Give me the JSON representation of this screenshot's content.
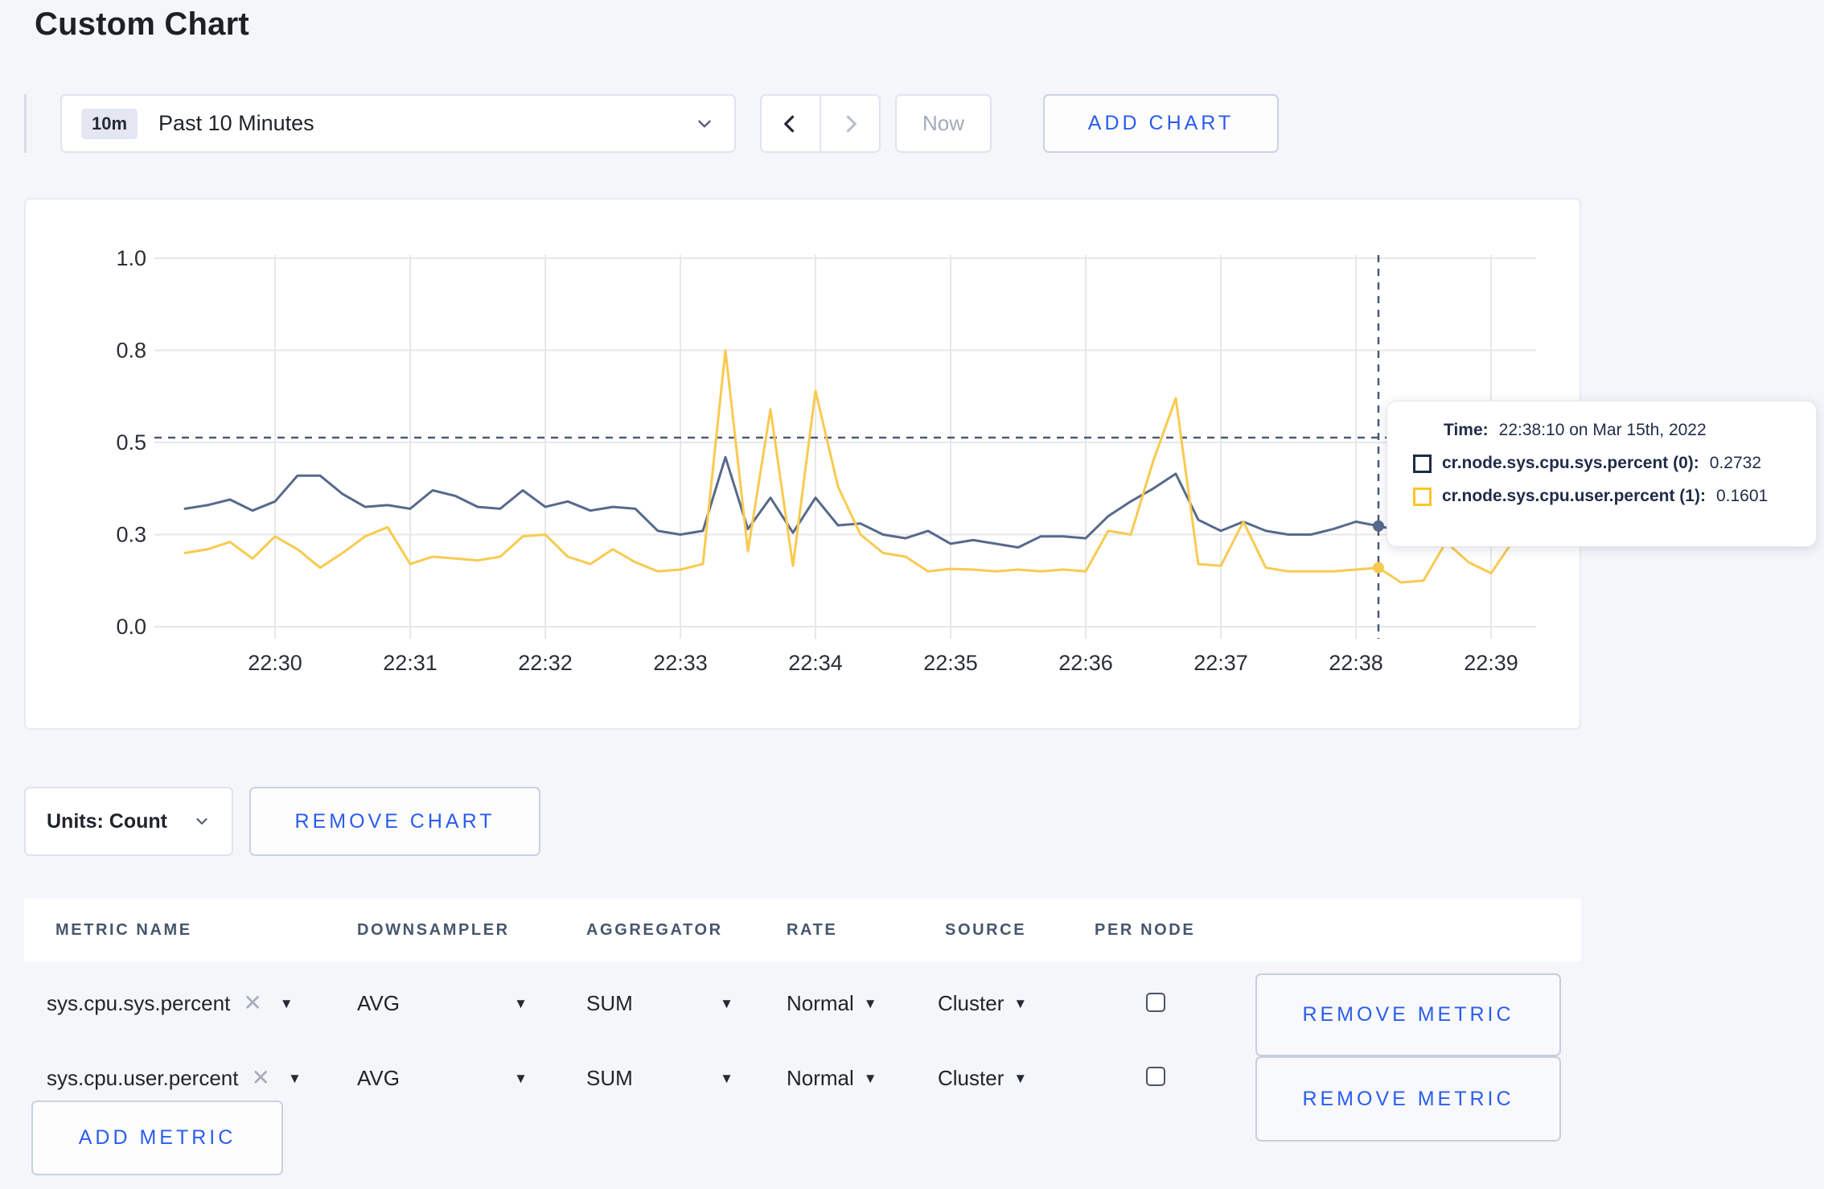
{
  "page_title": "Custom Chart",
  "toolbar": {
    "time_range_badge": "10m",
    "time_range_label": "Past 10 Minutes",
    "prev_label": "previous time window",
    "next_label": "next time window",
    "now_label": "Now",
    "add_chart_label": "ADD CHART"
  },
  "chart_data": {
    "type": "line",
    "title": "",
    "xlabel": "",
    "ylabel": "",
    "ylim": [
      0,
      1
    ],
    "grid": true,
    "x_start_time": "22:29:20",
    "x_step_seconds": 10,
    "x_tick_labels": [
      "22:30",
      "22:31",
      "22:32",
      "22:33",
      "22:34",
      "22:35",
      "22:36",
      "22:37",
      "22:38",
      "22:39"
    ],
    "y_ticks": [
      {
        "label": "0.0",
        "value": 0
      },
      {
        "label": "0.3",
        "value": 0.25
      },
      {
        "label": "0.5",
        "value": 0.5
      },
      {
        "label": "0.8",
        "value": 0.75
      },
      {
        "label": "1.0",
        "value": 1
      }
    ],
    "series": [
      {
        "name": "cr.node.sys.cpu.sys.percent",
        "color": "#57698c",
        "values": [
          0.32,
          0.33,
          0.345,
          0.315,
          0.34,
          0.41,
          0.41,
          0.36,
          0.325,
          0.33,
          0.32,
          0.37,
          0.355,
          0.325,
          0.32,
          0.37,
          0.325,
          0.34,
          0.315,
          0.325,
          0.32,
          0.26,
          0.25,
          0.26,
          0.46,
          0.265,
          0.35,
          0.255,
          0.35,
          0.275,
          0.28,
          0.25,
          0.24,
          0.26,
          0.225,
          0.235,
          0.225,
          0.215,
          0.245,
          0.245,
          0.24,
          0.3,
          0.34,
          0.375,
          0.415,
          0.29,
          0.26,
          0.285,
          0.26,
          0.25,
          0.25,
          0.265,
          0.285,
          0.2732,
          0.26,
          0.27,
          0.25,
          0.26,
          0.28,
          0.3
        ]
      },
      {
        "name": "cr.node.sys.cpu.user.percent",
        "color": "#f8ca4f",
        "values": [
          0.2,
          0.21,
          0.23,
          0.185,
          0.245,
          0.21,
          0.16,
          0.2,
          0.245,
          0.27,
          0.17,
          0.19,
          0.185,
          0.18,
          0.19,
          0.245,
          0.25,
          0.19,
          0.17,
          0.21,
          0.175,
          0.15,
          0.155,
          0.17,
          0.75,
          0.205,
          0.59,
          0.165,
          0.64,
          0.38,
          0.25,
          0.2,
          0.19,
          0.15,
          0.157,
          0.155,
          0.15,
          0.155,
          0.15,
          0.155,
          0.15,
          0.26,
          0.25,
          0.45,
          0.62,
          0.17,
          0.165,
          0.285,
          0.16,
          0.15,
          0.15,
          0.15,
          0.155,
          0.1601,
          0.12,
          0.125,
          0.23,
          0.175,
          0.145,
          0.235
        ]
      }
    ],
    "crosshair": {
      "time": "22:38:10",
      "x_index": 53,
      "h_line_value": 0.513
    }
  },
  "tooltip": {
    "time_label": "Time:",
    "time_value": "22:38:10 on Mar 15th, 2022",
    "series": [
      {
        "label": "cr.node.sys.cpu.sys.percent (0):",
        "value": "0.2732",
        "color": "#1c2b46"
      },
      {
        "label": "cr.node.sys.cpu.user.percent (1):",
        "value": "0.1601",
        "color": "#ffc425"
      }
    ]
  },
  "units_bar": {
    "units_label": "Units: Count",
    "remove_chart_label": "REMOVE CHART"
  },
  "metrics_table": {
    "headers": [
      "METRIC NAME",
      "DOWNSAMPLER",
      "AGGREGATOR",
      "RATE",
      "SOURCE",
      "PER NODE"
    ],
    "rows": [
      {
        "name": "sys.cpu.sys.percent",
        "downsampler": "AVG",
        "aggregator": "SUM",
        "rate": "Normal",
        "source": "Cluster",
        "per_node_checked": false,
        "remove_label": "REMOVE METRIC"
      },
      {
        "name": "sys.cpu.user.percent",
        "downsampler": "AVG",
        "aggregator": "SUM",
        "rate": "Normal",
        "source": "Cluster",
        "per_node_checked": false,
        "remove_label": "REMOVE METRIC"
      }
    ],
    "add_metric_label": "ADD METRIC"
  },
  "colors": {
    "accent_blue": "#2b5cf0",
    "page_background": "#f4f6fa",
    "gridline": "#e7e7e7",
    "crosshair": "#4a5a74"
  }
}
